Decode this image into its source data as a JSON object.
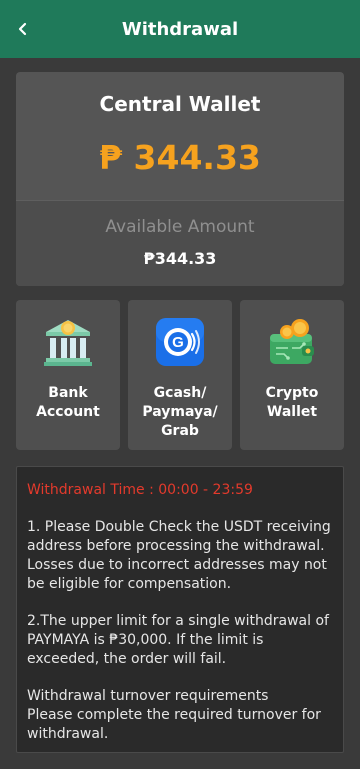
{
  "header": {
    "title": "Withdrawal",
    "back_icon": "chevron-left-icon"
  },
  "wallet": {
    "title": "Central Wallet",
    "balance": "₱ 344.33",
    "available_label": "Available Amount",
    "available_value": "₱344.33",
    "balance_color": "#f6a21e"
  },
  "methods": [
    {
      "label_line1": "Bank",
      "label_line2": "Account",
      "label_line3": "",
      "icon": "bank-icon"
    },
    {
      "label_line1": "Gcash/",
      "label_line2": "Paymaya/",
      "label_line3": "Grab",
      "icon": "gcash-icon"
    },
    {
      "label_line1": "Crypto",
      "label_line2": "Wallet",
      "label_line3": "",
      "icon": "crypto-wallet-icon"
    }
  ],
  "notice": {
    "time": "Withdrawal Time : 00:00 - 23:59",
    "item1": "1. Please Double Check the USDT receiving address before processing the withdrawal. Losses due to incorrect addresses may not be eligible for compensation.",
    "item2": "2.The upper limit for a single withdrawal of PAYMAYA is ₱30,000. If the limit is exceeded, the order will fail.",
    "item3_line1": "Withdrawal turnover requirements",
    "item3_line2": "Please complete the required turnover for withdrawal.",
    "time_color": "#e33a2c"
  },
  "colors": {
    "header_bg": "#1f7a5a",
    "page_bg": "#3a3a3a"
  }
}
